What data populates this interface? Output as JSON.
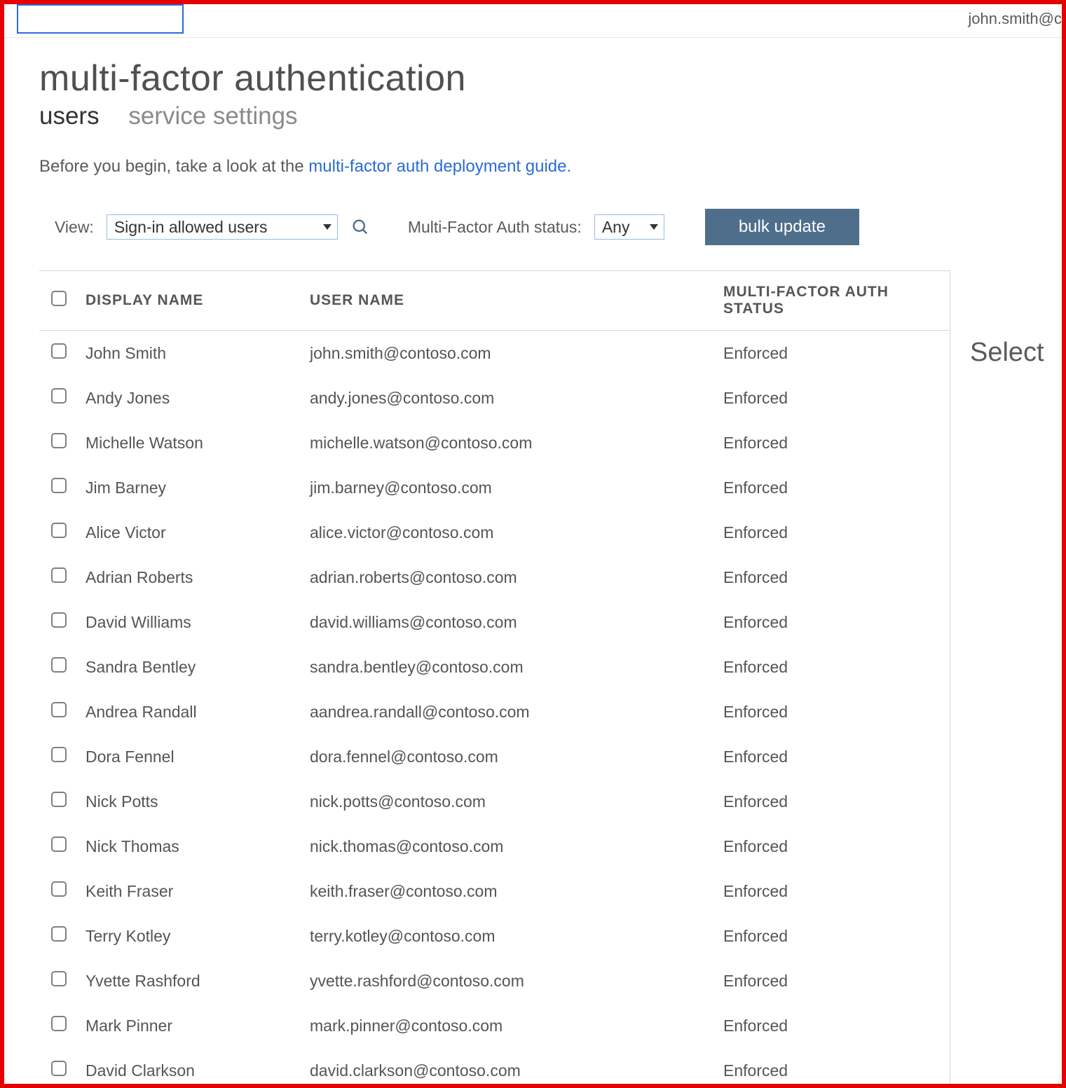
{
  "header": {
    "account_text": "john.smith@c"
  },
  "page": {
    "title": "multi-factor authentication",
    "tabs": [
      {
        "label": "users",
        "active": true
      },
      {
        "label": "service settings",
        "active": false
      }
    ],
    "intro_prefix": "Before you begin, take a look at the ",
    "intro_link": "multi-factor auth deployment guide.",
    "toolbar": {
      "view_label": "View:",
      "view_value": "Sign-in allowed users",
      "status_label": "Multi-Factor Auth status:",
      "status_value": "Any",
      "bulk_update_label": "bulk update"
    },
    "columns": {
      "display_name": "DISPLAY NAME",
      "user_name": "USER NAME",
      "mfa_status": "MULTI-FACTOR AUTH STATUS"
    },
    "sidepanel": {
      "hint": "Select"
    },
    "rows": [
      {
        "display_name": "John Smith",
        "user_name": "john.smith@contoso.com",
        "status": "Enforced"
      },
      {
        "display_name": "Andy Jones",
        "user_name": "andy.jones@contoso.com",
        "status": "Enforced"
      },
      {
        "display_name": "Michelle Watson",
        "user_name": "michelle.watson@contoso.com",
        "status": "Enforced"
      },
      {
        "display_name": "Jim Barney",
        "user_name": "jim.barney@contoso.com",
        "status": "Enforced"
      },
      {
        "display_name": "Alice Victor",
        "user_name": "alice.victor@contoso.com",
        "status": "Enforced"
      },
      {
        "display_name": "Adrian Roberts",
        "user_name": "adrian.roberts@contoso.com",
        "status": "Enforced"
      },
      {
        "display_name": "David Williams",
        "user_name": "david.williams@contoso.com",
        "status": "Enforced"
      },
      {
        "display_name": "Sandra Bentley",
        "user_name": "sandra.bentley@contoso.com",
        "status": "Enforced"
      },
      {
        "display_name": "Andrea Randall",
        "user_name": "aandrea.randall@contoso.com",
        "status": "Enforced"
      },
      {
        "display_name": "Dora Fennel",
        "user_name": "dora.fennel@contoso.com",
        "status": "Enforced"
      },
      {
        "display_name": "Nick Potts",
        "user_name": "nick.potts@contoso.com",
        "status": "Enforced"
      },
      {
        "display_name": "Nick Thomas",
        "user_name": "nick.thomas@contoso.com",
        "status": "Enforced"
      },
      {
        "display_name": "Keith Fraser",
        "user_name": "keith.fraser@contoso.com",
        "status": "Enforced"
      },
      {
        "display_name": "Terry Kotley",
        "user_name": "terry.kotley@contoso.com",
        "status": "Enforced"
      },
      {
        "display_name": "Yvette Rashford",
        "user_name": "yvette.rashford@contoso.com",
        "status": "Enforced"
      },
      {
        "display_name": "Mark Pinner",
        "user_name": "mark.pinner@contoso.com",
        "status": "Enforced"
      },
      {
        "display_name": "David Clarkson",
        "user_name": "david.clarkson@contoso.com",
        "status": "Enforced"
      }
    ]
  }
}
